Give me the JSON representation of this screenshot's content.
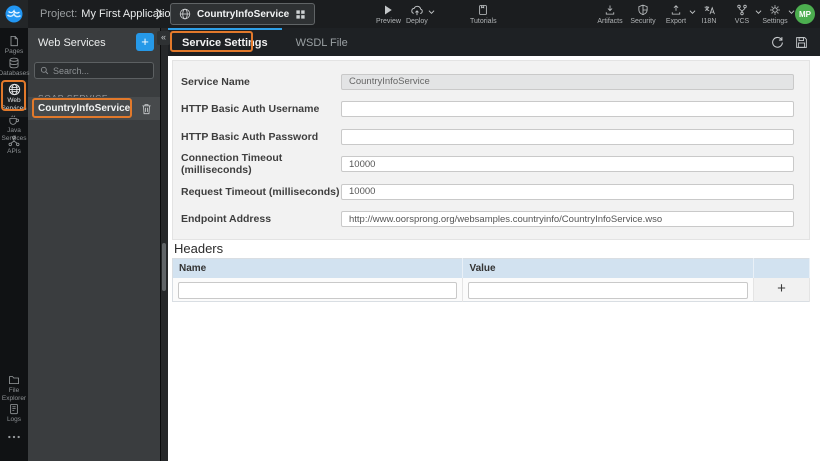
{
  "topbar": {
    "project_label": "Project:",
    "project_name": "My First Application",
    "entity_name": "CountryInfoService",
    "left_actions": [
      {
        "label": "Preview",
        "icon": "play-icon"
      },
      {
        "label": "Deploy",
        "icon": "cloud-upload-icon",
        "caret": "v"
      },
      {
        "label": "Tutorials",
        "icon": "book-icon"
      }
    ],
    "right_actions": [
      {
        "label": "Artifacts",
        "icon": "download-icon"
      },
      {
        "label": "Security",
        "icon": "shield-icon"
      },
      {
        "label": "Export",
        "icon": "export-icon",
        "caret": "v"
      },
      {
        "label": "I18N",
        "icon": "translate-icon"
      },
      {
        "label": "VCS",
        "icon": "branch-icon",
        "caret": "v"
      },
      {
        "label": "Settings",
        "icon": "gear-icon",
        "caret": "v"
      }
    ],
    "avatar_initials": "MP"
  },
  "rail": {
    "items": [
      {
        "label": "Pages",
        "icon": "page-icon"
      },
      {
        "label": "Databases",
        "icon": "database-icon"
      },
      {
        "label": "Web Services",
        "icon": "globe-icon",
        "active": true
      },
      {
        "label": "Java Services",
        "icon": "coffee-icon"
      },
      {
        "label": "APIs",
        "icon": "api-icon"
      }
    ],
    "bottom_items": [
      {
        "label": "File Explorer",
        "icon": "folder-icon"
      },
      {
        "label": "Logs",
        "icon": "log-icon"
      }
    ]
  },
  "panel": {
    "title": "Web Services",
    "add_button": "+",
    "collapse_glyph": "«",
    "search_placeholder": "Search...",
    "section_label": "SOAP SERVICE",
    "items": [
      {
        "name": "CountryInfoService"
      }
    ]
  },
  "tabs": {
    "items": [
      {
        "label": "Service Settings",
        "active": true
      },
      {
        "label": "WSDL File",
        "active": false
      }
    ]
  },
  "form": {
    "fields": [
      {
        "label": "Service Name",
        "value": "CountryInfoService",
        "disabled": true
      },
      {
        "label": "HTTP Basic Auth Username",
        "value": ""
      },
      {
        "label": "HTTP Basic Auth Password",
        "value": ""
      },
      {
        "label": "Connection Timeout (milliseconds)",
        "value": "10000"
      },
      {
        "label": "Request Timeout (milliseconds)",
        "value": "10000"
      },
      {
        "label": "Endpoint Address",
        "value": "http://www.oorsprong.org/websamples.countryinfo/CountryInfoService.wso"
      }
    ]
  },
  "headers_section": {
    "title": "Headers",
    "columns": {
      "name": "Name",
      "value": "Value"
    },
    "row": {
      "name_value": "",
      "value_value": ""
    },
    "add_button": "+"
  },
  "colors": {
    "accent_blue": "#2e9fe6",
    "annotation_orange": "#e2792b",
    "avatar_green": "#4cae4f",
    "table_header_blue": "#d2e2f0"
  }
}
